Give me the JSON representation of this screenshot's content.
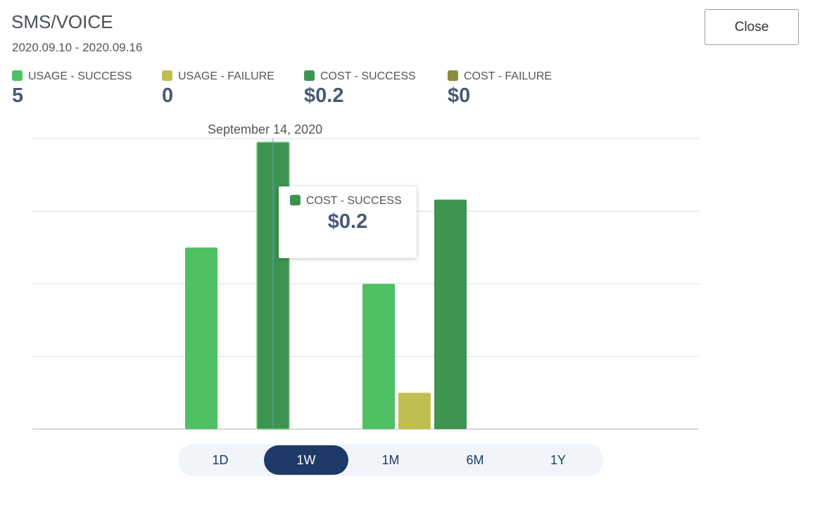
{
  "header": {
    "title": "SMS/VOICE",
    "date_range": "2020.09.10 - 2020.09.16",
    "close_label": "Close"
  },
  "legend": [
    {
      "label": "USAGE - SUCCESS",
      "value": "5",
      "color": "#4fc064"
    },
    {
      "label": "USAGE - FAILURE",
      "value": "0",
      "color": "#bfbf50"
    },
    {
      "label": "COST - SUCCESS",
      "value": "$0.2",
      "color": "#3d9451"
    },
    {
      "label": "COST - FAILURE",
      "value": "$0",
      "color": "#8c8c3c"
    }
  ],
  "tooltip": {
    "date": "September 14, 2020",
    "series": "COST - SUCCESS",
    "value": "$0.2",
    "color": "#3d9451"
  },
  "range_selector": {
    "options": [
      "1D",
      "1W",
      "1M",
      "6M",
      "1Y"
    ],
    "selected": "1W"
  },
  "chart_data": {
    "type": "bar",
    "title": "",
    "xlabel": "",
    "ylabel": "",
    "ylim": [
      0,
      4
    ],
    "grid": true,
    "y_units": "relative (gridline units, axis unlabeled)",
    "bars": [
      {
        "group": 1,
        "series": "USAGE - SUCCESS",
        "value": 2.5
      },
      {
        "group": 1,
        "series": "COST - SUCCESS",
        "value": 3.95,
        "hovered": true
      },
      {
        "group": 2,
        "series": "USAGE - SUCCESS",
        "value": 2.0
      },
      {
        "group": 2,
        "series": "USAGE - FAILURE",
        "value": 0.5
      },
      {
        "group": 2,
        "series": "COST - SUCCESS",
        "value": 3.16
      }
    ]
  }
}
